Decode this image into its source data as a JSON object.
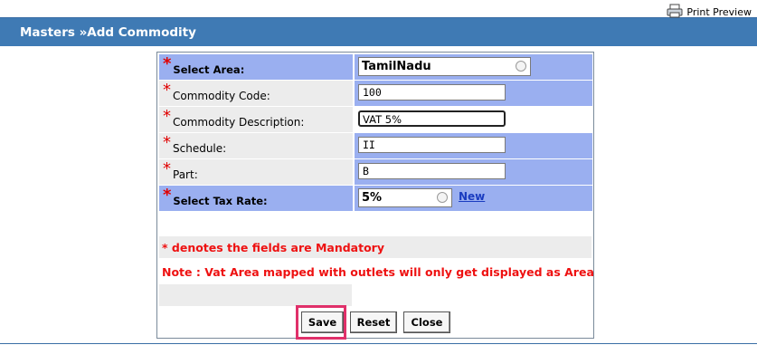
{
  "toolbar": {
    "print_preview": "Print Preview"
  },
  "header": {
    "title": "Masters »Add Commodity"
  },
  "form": {
    "select_area": {
      "label": "Select Area:",
      "value": "TamilNadu"
    },
    "commodity_code": {
      "label": "Commodity Code:",
      "value": "100"
    },
    "commodity_description": {
      "label": "Commodity Description:",
      "value": "VAT 5%"
    },
    "schedule": {
      "label": "Schedule:",
      "value": "II"
    },
    "part": {
      "label": "Part:",
      "value": "B"
    },
    "select_tax_rate": {
      "label": "Select Tax Rate:",
      "value": "5%",
      "new_link": "New"
    },
    "required_marker": "*"
  },
  "notes": {
    "mandatory": "* denotes the fields are Mandatory",
    "vat_area": "Note : Vat Area mapped with outlets will only get displayed as Area"
  },
  "buttons": {
    "save": "Save",
    "reset": "Reset",
    "close": "Close"
  },
  "colors": {
    "header_bg": "#3f7ab4",
    "row_blue": "#9aaff0",
    "row_gray": "#ececec",
    "required": "#ee1111",
    "highlight": "#e0306a"
  }
}
